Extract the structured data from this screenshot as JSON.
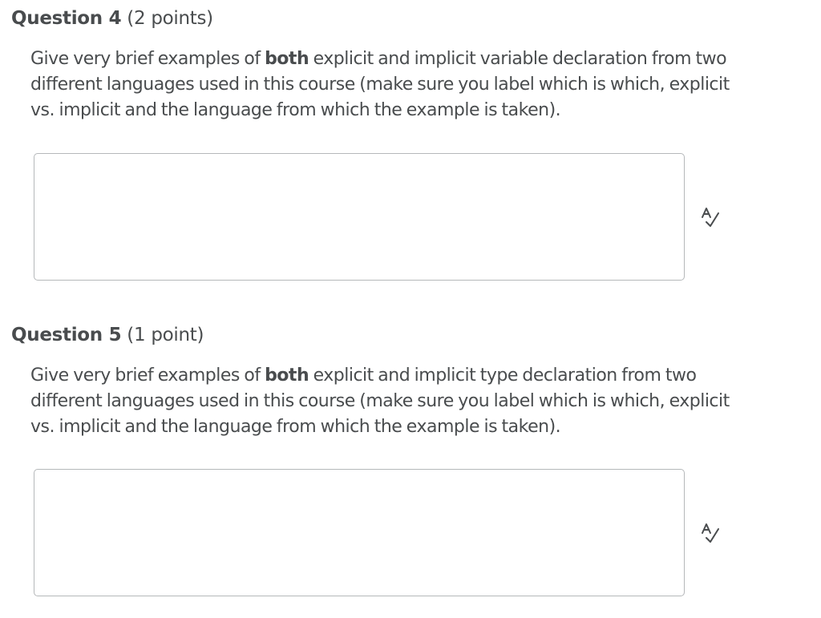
{
  "questions": [
    {
      "name": "Question 4",
      "points": "(2 points)",
      "text": {
        "line1_before": "Give very brief examples of ",
        "line1_bold": "both",
        "line1_after": " explicit and implicit variable declaration from two",
        "line2": "different languages used in this course (make sure you label which is which, explicit",
        "line3": "vs. implicit and the language from which the example is taken)."
      },
      "answer": {
        "value": "",
        "icon": "spellcheck-icon"
      }
    },
    {
      "name": "Question 5",
      "points": "(1 point)",
      "text": {
        "line1_before": "Give very brief examples of ",
        "line1_bold": "both",
        "line1_after": " explicit and implicit type declaration from two",
        "line2": "different languages used in this course (make sure you label which is which, explicit",
        "line3": "vs. implicit and the language from which the example is taken)."
      },
      "answer": {
        "value": "",
        "icon": "spellcheck-icon"
      }
    }
  ],
  "colors": {
    "text": "#494c4e",
    "box_border": "#b5b8ba",
    "background": "#ffffff"
  }
}
